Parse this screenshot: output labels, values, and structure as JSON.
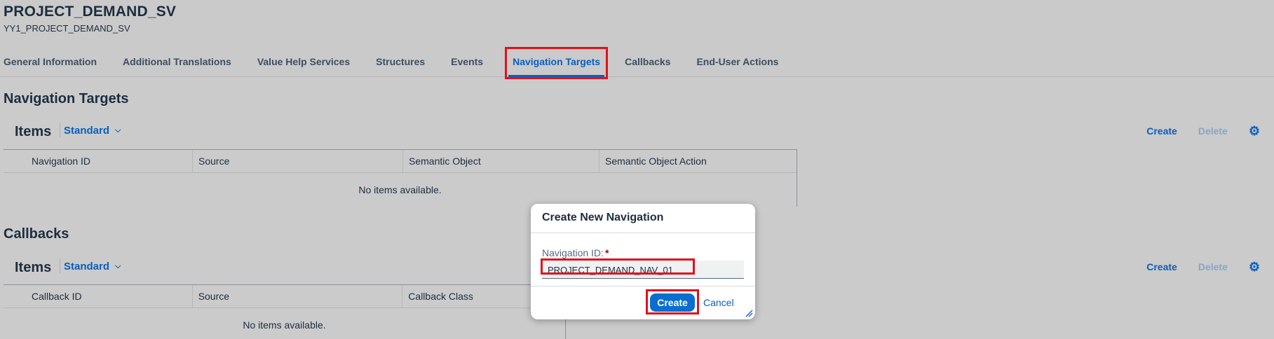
{
  "header": {
    "title": "PROJECT_DEMAND_SV",
    "subtitle": "YY1_PROJECT_DEMAND_SV",
    "tabs": [
      {
        "label": "General Information"
      },
      {
        "label": "Additional Translations"
      },
      {
        "label": "Value Help Services"
      },
      {
        "label": "Structures"
      },
      {
        "label": "Events"
      },
      {
        "label": "Navigation Targets"
      },
      {
        "label": "Callbacks"
      },
      {
        "label": "End-User Actions"
      }
    ]
  },
  "navigation_targets": {
    "section_title": "Navigation Targets",
    "items_title": "Items",
    "variant": "Standard",
    "create": "Create",
    "delete": "Delete",
    "columns": [
      "Navigation ID",
      "Source",
      "Semantic Object",
      "Semantic Object Action"
    ],
    "empty_text": "No items available."
  },
  "callbacks": {
    "section_title": "Callbacks",
    "items_title": "Items",
    "variant": "Standard",
    "create": "Create",
    "delete": "Delete",
    "columns": [
      "Callback ID",
      "Source",
      "Callback Class"
    ],
    "empty_text": "No items available."
  },
  "dialog": {
    "title": "Create New Navigation",
    "field_label": "Navigation ID:",
    "required_mark": "*",
    "field_value": "PROJECT_DEMAND_NAV_01",
    "create": "Create",
    "cancel": "Cancel"
  },
  "colors": {
    "accent": "#0a5fbd",
    "highlight": "#e3101a",
    "background": "#cbcbcb"
  }
}
